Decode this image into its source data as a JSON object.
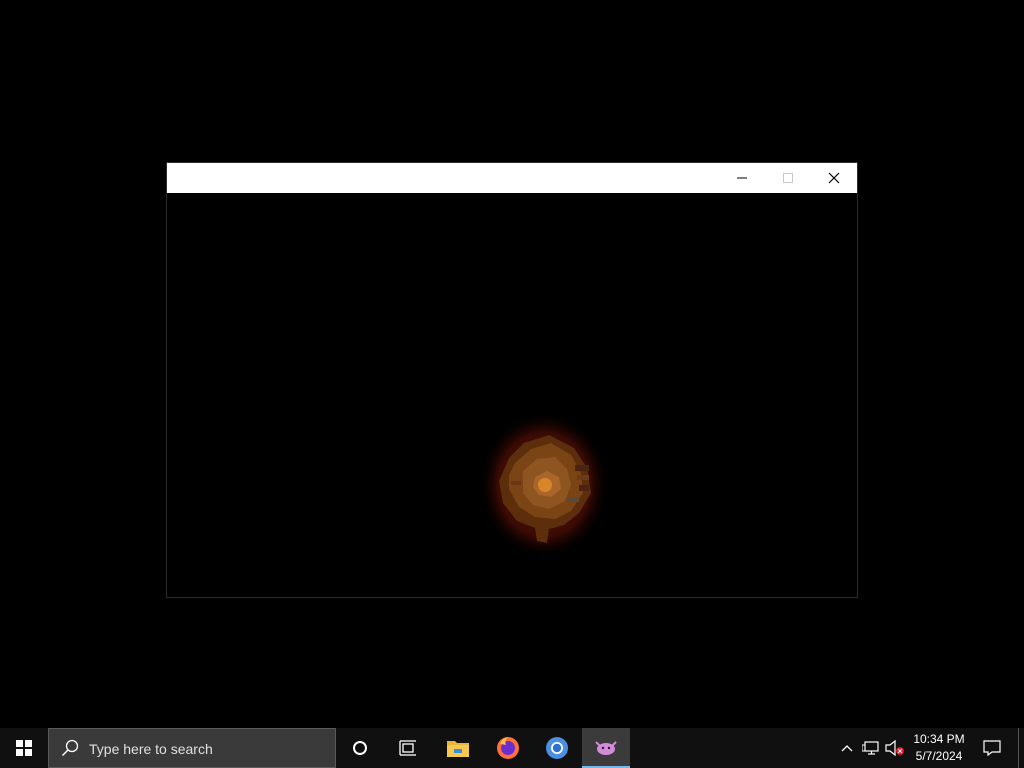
{
  "window": {
    "title": "",
    "controls": {
      "minimize_icon": "minimize-icon",
      "maximize_icon": "maximize-icon",
      "close_icon": "close-icon"
    },
    "content": "dark canvas with glowing orange-brown blob sprite"
  },
  "taskbar": {
    "search": {
      "placeholder": "Type here to search"
    },
    "apps": [
      {
        "name": "Cortana",
        "icon": "cortana-circle-icon",
        "active": false
      },
      {
        "name": "Task View",
        "icon": "task-view-icon",
        "active": false
      },
      {
        "name": "File Explorer",
        "icon": "folder-icon",
        "active": false
      },
      {
        "name": "Firefox",
        "icon": "firefox-icon",
        "active": false
      },
      {
        "name": "Chrome",
        "icon": "chrome-icon",
        "active": false
      },
      {
        "name": "Game",
        "icon": "pink-creature-icon",
        "active": true
      }
    ],
    "tray": {
      "overflow_icon": "chevron-up-icon",
      "network_icon": "network-icon",
      "volume_icon": "volume-muted-icon"
    },
    "clock": {
      "time": "10:34 PM",
      "date": "5/7/2024"
    }
  },
  "colors": {
    "taskbar_bg": "#101010",
    "search_bg": "#3a3a3a",
    "accent_underline": "#76b9ed",
    "sprite_core": "#d9862b"
  }
}
